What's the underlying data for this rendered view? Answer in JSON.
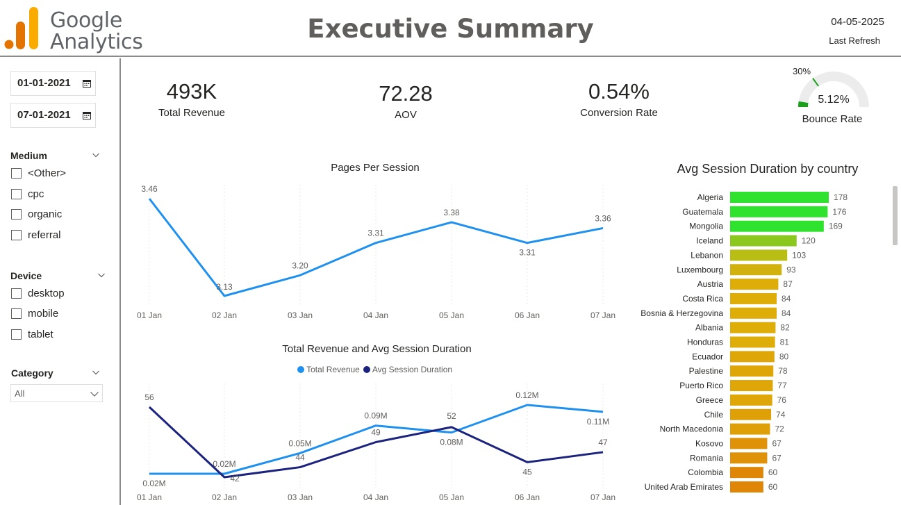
{
  "header": {
    "logo_text_line1": "Google",
    "logo_text_line2": "Analytics",
    "title": "Executive Summary",
    "refresh_date": "04-05-2025",
    "refresh_label": "Last Refresh"
  },
  "filters": {
    "start_date": "01-01-2021",
    "end_date": "07-01-2021",
    "medium": {
      "title": "Medium",
      "options": [
        "<Other>",
        "cpc",
        "organic",
        "referral"
      ]
    },
    "device": {
      "title": "Device",
      "options": [
        "desktop",
        "mobile",
        "tablet"
      ]
    },
    "category": {
      "title": "Category",
      "selected": "All"
    }
  },
  "kpis": {
    "total_revenue": {
      "value": "493K",
      "label": "Total Revenue"
    },
    "aov": {
      "value": "72.28",
      "label": "AOV"
    },
    "conversion_rate": {
      "value": "0.54%",
      "label": "Conversion Rate"
    },
    "bounce_rate": {
      "value": "5.12%",
      "label": "Bounce Rate",
      "target_label": "30%",
      "value_fraction": 0.0512,
      "target_fraction": 0.3
    }
  },
  "colors": {
    "light_blue": "#1e90ef",
    "navy": "#1b237e",
    "gauge_fill": "#1ba01b",
    "gauge_bg": "#ececec"
  },
  "chart_data": [
    {
      "type": "line",
      "title": "Pages Per Session",
      "categories": [
        "01 Jan",
        "02 Jan",
        "03 Jan",
        "04 Jan",
        "05 Jan",
        "06 Jan",
        "07 Jan"
      ],
      "series": [
        {
          "values": [
            3.46,
            3.13,
            3.2,
            3.31,
            3.38,
            3.31,
            3.36
          ],
          "labels": [
            "3.46",
            "3.13",
            "3.20",
            "3.31",
            "3.38",
            "3.31",
            "3.36"
          ]
        }
      ],
      "ylim": [
        3.13,
        3.46
      ],
      "grid": false
    },
    {
      "type": "line",
      "title": "Total Revenue and Avg Session Duration",
      "legend": "top",
      "categories": [
        "01 Jan",
        "02 Jan",
        "03 Jan",
        "04 Jan",
        "05 Jan",
        "06 Jan",
        "07 Jan"
      ],
      "series": [
        {
          "name": "Total Revenue",
          "values": [
            0.02,
            0.02,
            0.05,
            0.09,
            0.08,
            0.12,
            0.11
          ],
          "labels": [
            "0.02M",
            "0.02M",
            "0.05M",
            "0.09M",
            "0.08M",
            "0.12M",
            "0.11M"
          ]
        },
        {
          "name": "Avg Session Duration",
          "values": [
            56,
            42,
            44,
            49,
            52,
            45,
            47
          ],
          "labels": [
            "56",
            "42",
            "44",
            "49",
            "52",
            "45",
            "47"
          ]
        }
      ],
      "grid": false
    },
    {
      "type": "bar",
      "orientation": "horizontal",
      "title": "Avg Session Duration by country",
      "categories": [
        "Algeria",
        "Guatemala",
        "Mongolia",
        "Iceland",
        "Lebanon",
        "Luxembourg",
        "Austria",
        "Costa Rica",
        "Bosnia & Herzegovina",
        "Albania",
        "Honduras",
        "Ecuador",
        "Palestine",
        "Puerto Rico",
        "Greece",
        "Chile",
        "North Macedonia",
        "Kosovo",
        "Romania",
        "Colombia",
        "United Arab Emirates"
      ],
      "values": [
        178,
        176,
        169,
        120,
        103,
        93,
        87,
        84,
        84,
        82,
        81,
        80,
        78,
        77,
        76,
        74,
        72,
        67,
        67,
        60,
        60
      ],
      "bar_colors": [
        "#2ee22e",
        "#2ee22e",
        "#2ee22e",
        "#8ac81d",
        "#b8be14",
        "#d1b10e",
        "#dfad07",
        "#dfad07",
        "#dfad07",
        "#dfad07",
        "#dfad07",
        "#dfa607",
        "#dfa607",
        "#dfa607",
        "#dfa607",
        "#df9f07",
        "#df9f07",
        "#df9207",
        "#df9207",
        "#df8607",
        "#df8607"
      ]
    }
  ]
}
